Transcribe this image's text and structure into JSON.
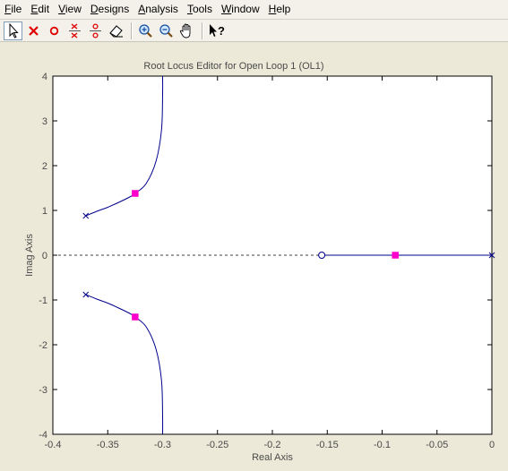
{
  "menu": [
    {
      "underline": "F",
      "rest": "ile"
    },
    {
      "underline": "E",
      "rest": "dit"
    },
    {
      "underline": "V",
      "rest": "iew"
    },
    {
      "underline": "D",
      "rest": "esigns"
    },
    {
      "underline": "A",
      "rest": "nalysis"
    },
    {
      "underline": "T",
      "rest": "ools"
    },
    {
      "underline": "W",
      "rest": "indow"
    },
    {
      "underline": "H",
      "rest": "elp"
    }
  ],
  "toolbar": [
    {
      "name": "select-arrow-icon",
      "active": true
    },
    {
      "name": "add-real-pole-icon"
    },
    {
      "name": "add-real-zero-icon"
    },
    {
      "name": "add-complex-pole-icon"
    },
    {
      "name": "add-complex-zero-icon"
    },
    {
      "name": "eraser-icon"
    },
    {
      "sep": true
    },
    {
      "name": "zoom-in-icon"
    },
    {
      "name": "zoom-out-icon"
    },
    {
      "name": "pan-hand-icon"
    },
    {
      "sep": true
    },
    {
      "name": "whats-this-help-icon"
    }
  ],
  "colors": {
    "locus": "#00008b",
    "marker": "#ff00cc",
    "pole": "#00008b",
    "zero": "#00008b",
    "plot_bg": "#ffffff",
    "window_bg": "#ece9d8"
  },
  "chart_data": {
    "type": "line",
    "title": "Root Locus Editor for Open Loop 1 (OL1)",
    "xlabel": "Real Axis",
    "ylabel": "Imag Axis",
    "xlim": [
      -0.4,
      0
    ],
    "ylim": [
      -4,
      4
    ],
    "xticks": [
      -0.4,
      -0.35,
      -0.3,
      -0.25,
      -0.2,
      -0.15,
      -0.1,
      -0.05,
      0
    ],
    "xtick_labels": [
      "-0.4",
      "-0.35",
      "-0.3",
      "-0.25",
      "-0.2",
      "-0.15",
      "-0.1",
      "-0.05",
      "0"
    ],
    "yticks": [
      4,
      3,
      2,
      1,
      0,
      -1,
      -2,
      -3,
      -4
    ],
    "ytick_labels": [
      "4",
      "3",
      "2",
      "1",
      "0",
      "-1",
      "-2",
      "-3",
      "-4"
    ],
    "grid": false,
    "series": [
      {
        "x": [
          -0.37,
          -0.36,
          -0.35,
          -0.34,
          -0.33,
          -0.325,
          -0.315,
          -0.306,
          -0.301,
          -0.3,
          -0.3
        ],
        "y": [
          0.88,
          0.98,
          1.07,
          1.18,
          1.3,
          1.38,
          1.6,
          2.1,
          2.8,
          3.6,
          4.0
        ]
      },
      {
        "x": [
          -0.37,
          -0.36,
          -0.35,
          -0.34,
          -0.33,
          -0.325,
          -0.315,
          -0.306,
          -0.301,
          -0.3,
          -0.3
        ],
        "y": [
          -0.88,
          -0.98,
          -1.07,
          -1.18,
          -1.3,
          -1.38,
          -1.6,
          -2.1,
          -2.8,
          -3.6,
          -4.0
        ]
      },
      {
        "x": [
          -0.155,
          0
        ],
        "y": [
          0,
          0
        ]
      }
    ],
    "poles": [
      [
        -0.37,
        0.88
      ],
      [
        -0.37,
        -0.88
      ],
      [
        0,
        0
      ]
    ],
    "zeros": [
      [
        -0.155,
        0
      ]
    ],
    "closed_loop_markers": [
      [
        -0.325,
        1.38
      ],
      [
        -0.325,
        -1.38
      ],
      [
        -0.088,
        0
      ]
    ],
    "reference_line": {
      "y": 0,
      "style": "dashed"
    }
  }
}
